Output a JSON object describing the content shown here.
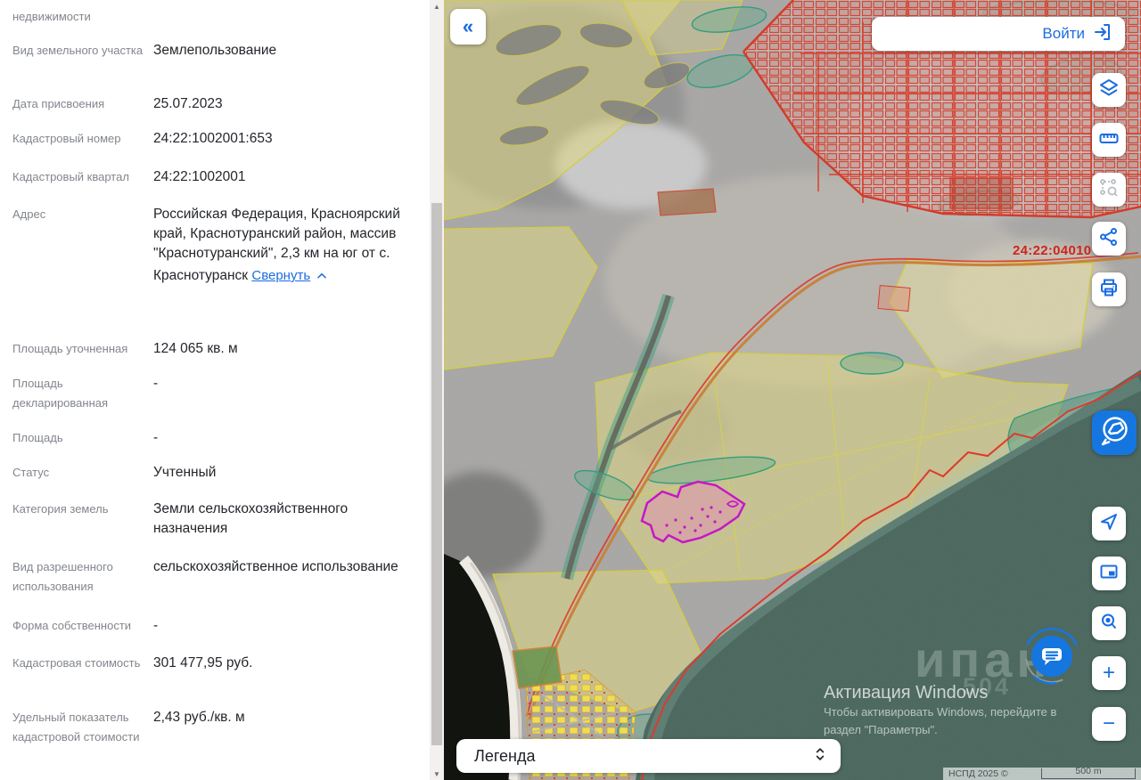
{
  "panel": {
    "rows": [
      {
        "label": "недвижимости",
        "value": ""
      },
      {
        "label": "Вид земельного участка",
        "value": "Землепользование"
      },
      {
        "label": "Дата присвоения",
        "value": "25.07.2023"
      },
      {
        "label": "Кадастровый номер",
        "value": "24:22:1002001:653"
      },
      {
        "label": "Кадастровый квартал",
        "value": "24:22:1002001"
      },
      {
        "label": "Адрес",
        "value": "Российская Федерация, Красноярский край, Краснотуранский район, массив \"Краснотуранский\", 2,3 км на юг от с. Краснотуранск",
        "action": "Свернуть"
      },
      {
        "label": "Площадь уточненная",
        "value": "124 065 кв. м"
      },
      {
        "label": "Площадь декларированная",
        "value": "-"
      },
      {
        "label": "Площадь",
        "value": "-"
      },
      {
        "label": "Статус",
        "value": "Учтенный"
      },
      {
        "label": "Категория земель",
        "value": "Земли сельскохозяйственного назначения"
      },
      {
        "label": "Вид разрешенного использования",
        "value": "сельскохозяйственное использование"
      },
      {
        "label": "Форма собственности",
        "value": "-"
      },
      {
        "label": "Кадастровая стоимость",
        "value": "301 477,95 руб."
      },
      {
        "label": "Удельный показатель кадастровой стоимости",
        "value": "2,43 руб./кв. м"
      }
    ]
  },
  "map": {
    "collapse_button": "«",
    "login_label": "Войти",
    "parcel_map_label": "24:22:04010",
    "legend_title": "Легенда",
    "zoom_in": "+",
    "zoom_out": "−",
    "attribution_text": "НСПД 2025 ©",
    "scale_label": "500 m",
    "windows_watermark": {
      "title": "Активация Windows",
      "line1": "Чтобы активировать Windows, перейдите в",
      "line2": "раздел \"Параметры\"."
    },
    "brand_watermark": {
      "text": "ипан",
      "digits": "504"
    },
    "toolbar_icons": [
      "layers-icon",
      "ruler-icon",
      "geometry-search-icon",
      "share-icon",
      "printer-icon",
      "area-select-icon",
      "locate-icon",
      "overview-map-icon",
      "coordinate-search-icon",
      "chat-icon"
    ]
  },
  "colors": {
    "accent_blue": "#1b6ce0",
    "cadastre_red": "#d7402e",
    "selected_parcel_magenta": "#c617c6",
    "field_yellow": "#e2d982",
    "forest_teal": "#2f9d7d",
    "water": "#4a675e"
  }
}
